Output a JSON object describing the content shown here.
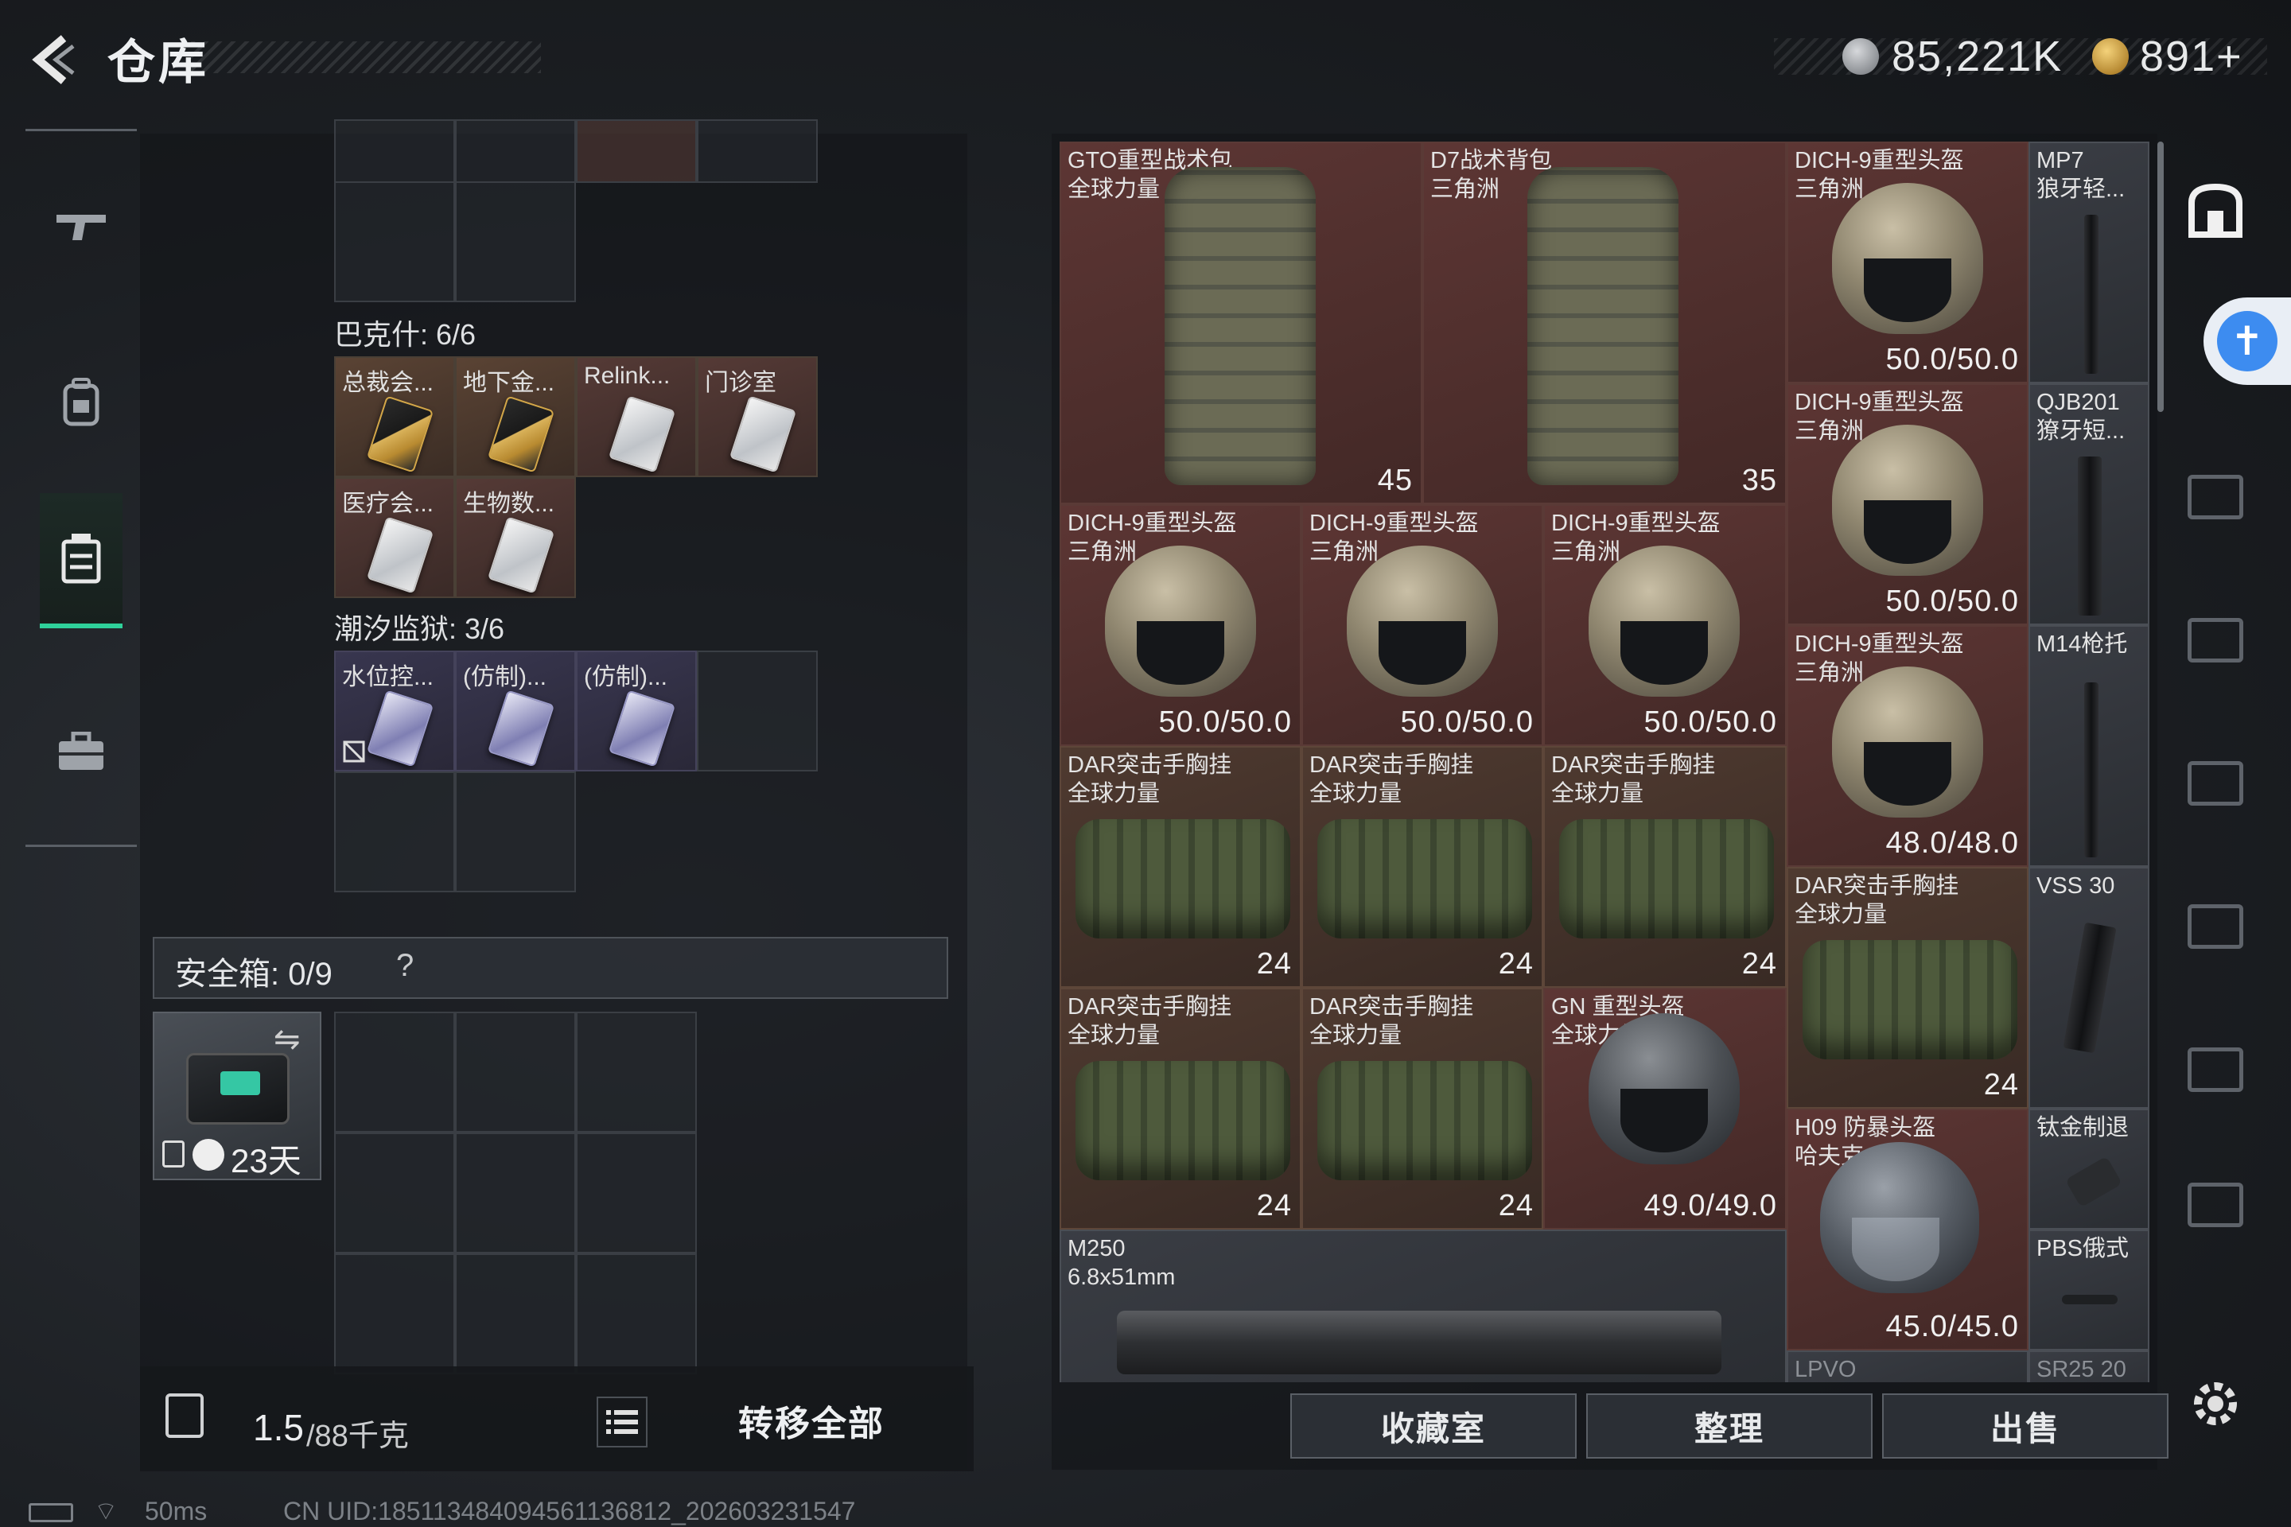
{
  "header": {
    "title": "仓库",
    "currency_1": "85,221K",
    "currency_2": "891+"
  },
  "left_panel": {
    "section_1_label": "巴克什: 6/6",
    "section_1_items": [
      {
        "label": "总裁会...",
        "style": "gold"
      },
      {
        "label": "地下金...",
        "style": "gold"
      },
      {
        "label": "Relink...",
        "style": "red"
      },
      {
        "label": "门诊室",
        "style": "red"
      },
      {
        "label": "医疗会...",
        "style": "red"
      },
      {
        "label": "生物数...",
        "style": "red"
      }
    ],
    "section_2_label": "潮汐监狱: 3/6",
    "section_2_items": [
      {
        "label": "水位控...",
        "style": "purple"
      },
      {
        "label": "(仿制)...",
        "style": "purple"
      },
      {
        "label": "(仿制)...",
        "style": "purple"
      }
    ],
    "safebox_label": "安全箱: 0/9",
    "safebox_help": "?",
    "safebox_timer": "23天",
    "weight": "1.5",
    "weight_max": "/88千克",
    "transfer_all": "转移全部"
  },
  "stash": {
    "items": [
      {
        "name1": "GTO重型战术包",
        "name2": "全球力量",
        "value": "45"
      },
      {
        "name1": "D7战术背包",
        "name2": "三角洲",
        "value": "35"
      },
      {
        "name1": "DICH-9重型头盔",
        "name2": "三角洲",
        "value": "50.0/50.0"
      },
      {
        "name1": "MP7",
        "name2": "狼牙轻..."
      },
      {
        "name1": "DICH-9重型头盔",
        "name2": "三角洲",
        "value": "50.0/50.0"
      },
      {
        "name1": "QJB201",
        "name2": "獠牙短..."
      },
      {
        "name1": "DICH-9重型头盔",
        "name2": "三角洲",
        "value": "50.0/50.0"
      },
      {
        "name1": "DICH-9重型头盔",
        "name2": "三角洲",
        "value": "50.0/50.0"
      },
      {
        "name1": "DICH-9重型头盔",
        "name2": "三角洲",
        "value": "50.0/50.0"
      },
      {
        "name1": "DICH-9重型头盔",
        "name2": "三角洲",
        "value": "48.0/48.0"
      },
      {
        "name1": "M14枪托"
      },
      {
        "name1": "DAR突击手胸挂",
        "name2": "全球力量",
        "value": "24"
      },
      {
        "name1": "DAR突击手胸挂",
        "name2": "全球力量",
        "value": "24"
      },
      {
        "name1": "DAR突击手胸挂",
        "name2": "全球力量",
        "value": "24"
      },
      {
        "name1": "DAR突击手胸挂",
        "name2": "全球力量",
        "value": "24"
      },
      {
        "name1": "VSS 30"
      },
      {
        "name1": "DAR突击手胸挂",
        "name2": "全球力量",
        "value": "24"
      },
      {
        "name1": "DAR突击手胸挂",
        "name2": "全球力量",
        "value": "24"
      },
      {
        "name1": "GN 重型头盔",
        "name2": "全球力量",
        "value": "49.0/49.0"
      },
      {
        "name1": "H09 防暴头盔",
        "name2": "哈夫克",
        "value": "45.0/45.0"
      },
      {
        "name1": "钛金制退"
      },
      {
        "name1": "PBS俄式"
      },
      {
        "name1": "M250",
        "name2": "6.8x51mm"
      },
      {
        "name1": "LPVO"
      },
      {
        "name1": "SR25 20"
      }
    ],
    "buttons": {
      "collection": "收藏室",
      "sort": "整理",
      "sell": "出售"
    }
  },
  "status_bar": {
    "ping": "50ms",
    "uid": "CN UID:185113484094561136812_202603231547"
  },
  "colors": {
    "accent_green": "#2fd19a",
    "accessibility_blue": "#3d8cf0"
  }
}
